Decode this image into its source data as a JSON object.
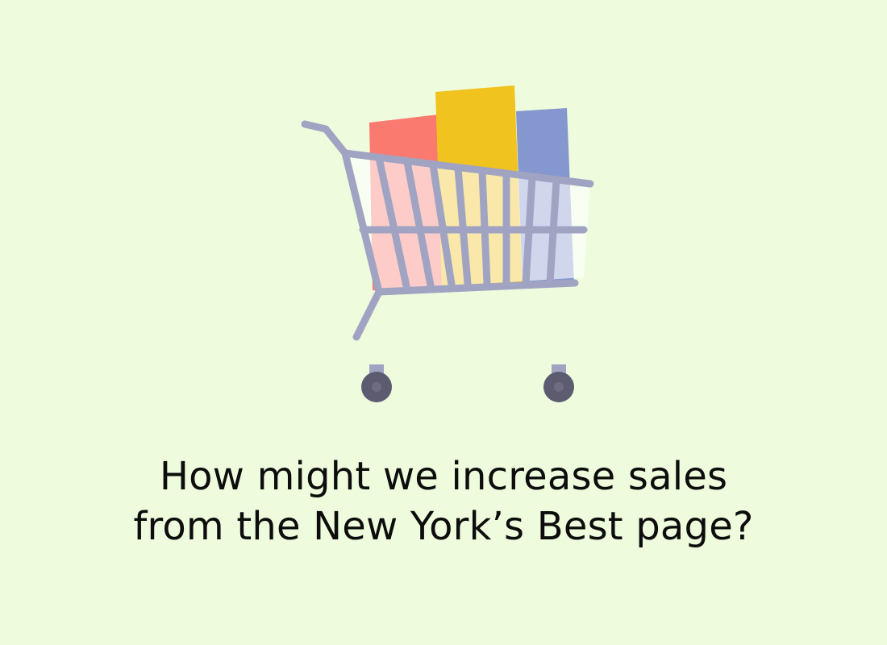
{
  "illustration": {
    "icon": "shopping-cart-icon",
    "items": [
      "red-box",
      "yellow-box",
      "blue-box"
    ],
    "colors": {
      "background": "#eefcdd",
      "cart": "#a0a4c2",
      "wheel": "#5d5b70",
      "box_red": "#fa7a70",
      "box_yellow": "#f0c31e",
      "box_blue": "#8497cf",
      "text": "#0d0d0d"
    }
  },
  "question": {
    "line1": "How might we increase sales",
    "line2": "from the New York’s Best page?"
  }
}
